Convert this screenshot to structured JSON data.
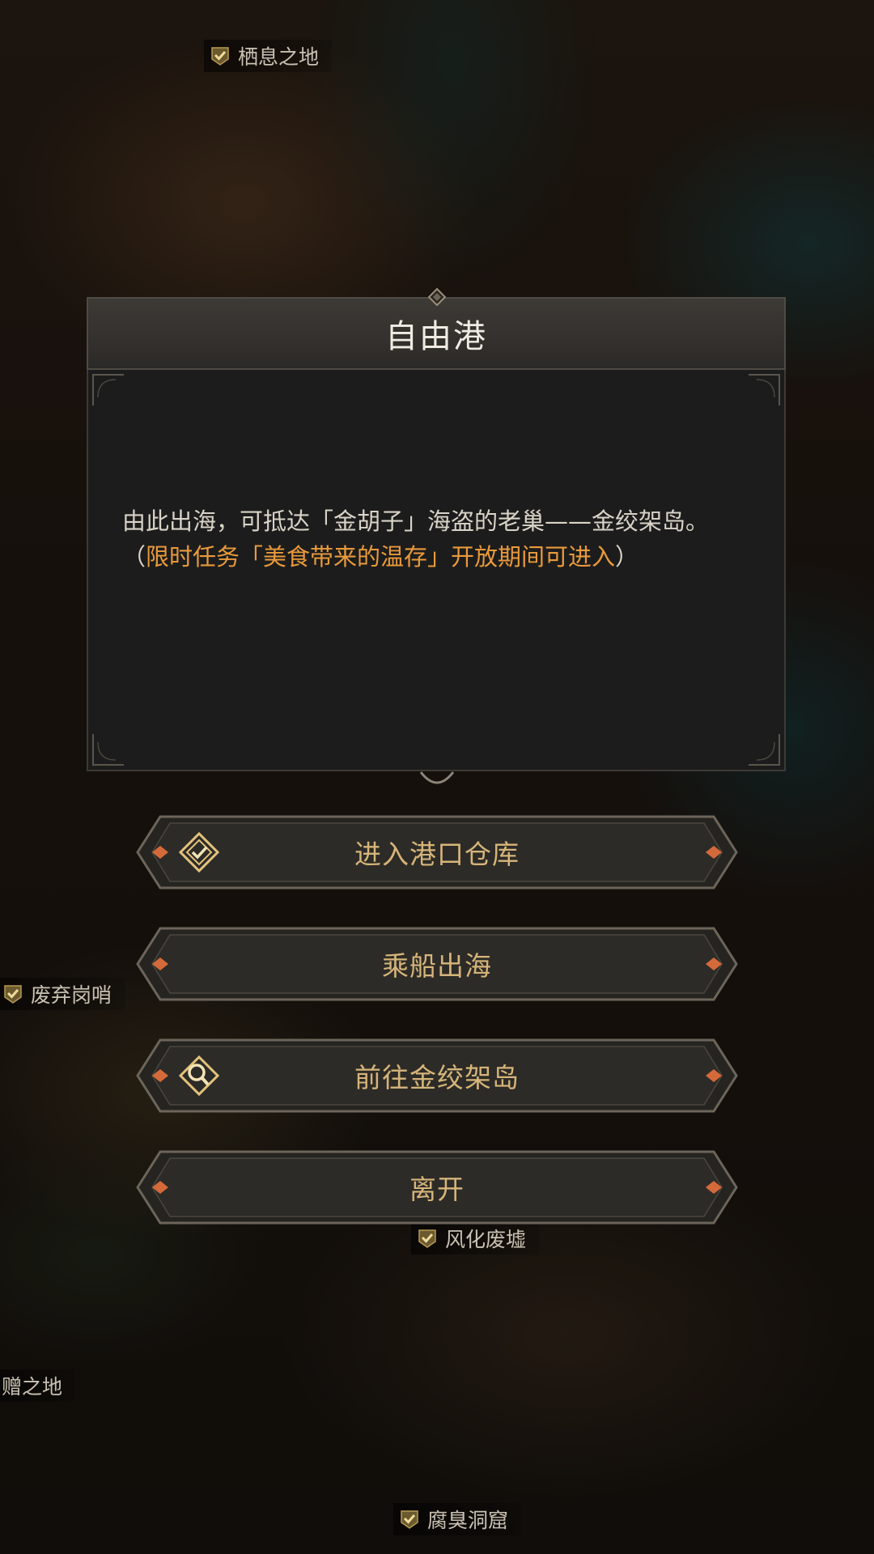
{
  "map_labels": {
    "top": "栖息之地",
    "left": "废弃岗哨",
    "center": "风化废墟",
    "lower_left": "赠之地",
    "bottom": "腐臭洞窟"
  },
  "dialog": {
    "title": "自由港",
    "description": "由此出海，可抵达「金胡子」海盗的老巢——金绞架岛。",
    "note_open": "（",
    "note_highlight": "限时任务「美食带来的温存」开放期间可进入",
    "note_close": "）"
  },
  "buttons": [
    {
      "label": "进入港口仓库",
      "icon": "diamond-check-icon"
    },
    {
      "label": "乘船出海",
      "icon": ""
    },
    {
      "label": "前往金绞架岛",
      "icon": "magnifier-icon"
    },
    {
      "label": "离开",
      "icon": ""
    }
  ],
  "colors": {
    "accent_orange": "#e99a3b",
    "button_text": "#d6b57a",
    "title_text": "#f1ece3"
  }
}
